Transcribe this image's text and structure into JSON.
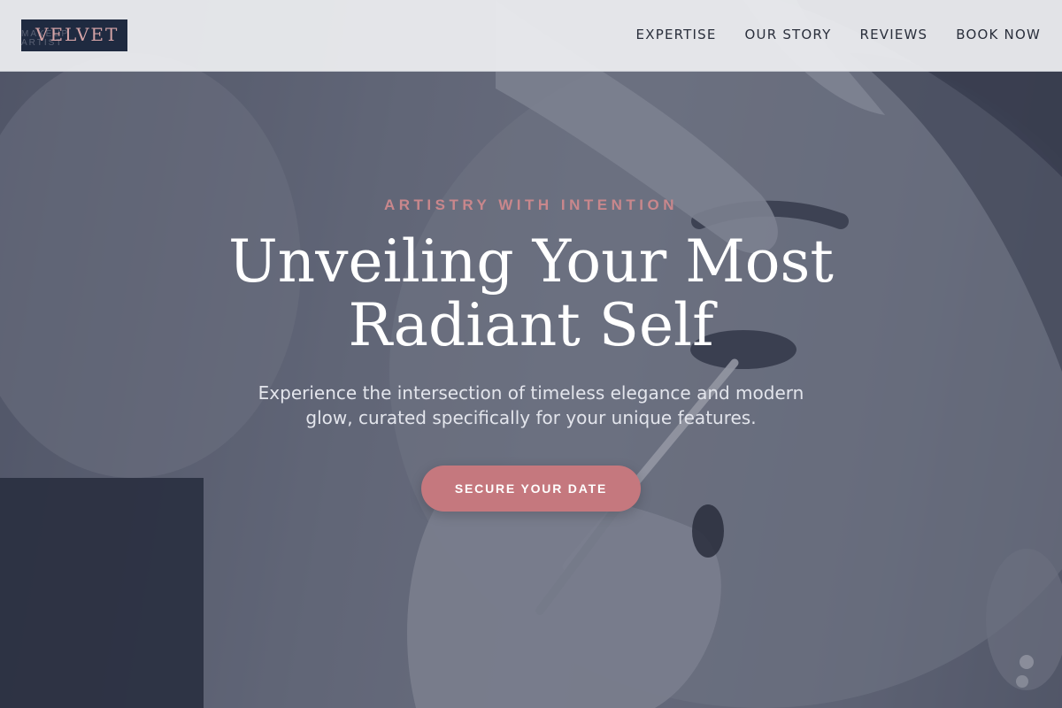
{
  "header": {
    "logo": {
      "word": "VELVET",
      "sub_lines": [
        "MAKEUP",
        "ARTIST"
      ]
    },
    "nav": [
      {
        "label": "EXPERTISE"
      },
      {
        "label": "OUR STORY"
      },
      {
        "label": "REVIEWS"
      },
      {
        "label": "BOOK NOW"
      }
    ]
  },
  "hero": {
    "eyebrow": "ARTISTRY WITH INTENTION",
    "title_lines": [
      "Unveiling Your Most",
      "Radiant Self"
    ],
    "subtitle": "Experience the intersection of timeless elegance and modern glow, curated specifically for your unique features.",
    "cta_label": "SECURE YOUR DATE",
    "background": "makeup-application-photo"
  },
  "colors": {
    "accent": "#c5787e",
    "eyebrow": "#c9878c",
    "logo_bg": "#1f2a40",
    "header_bg": "#e9eaed",
    "nav_text": "#2a2f3c"
  }
}
